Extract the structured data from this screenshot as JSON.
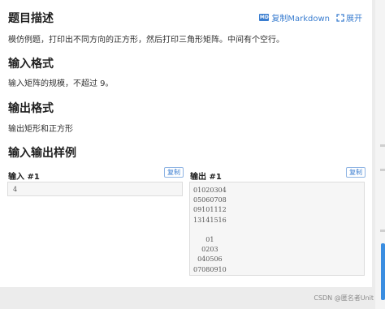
{
  "toolbar": {
    "copy_markdown_label": "复制Markdown",
    "expand_label": "展开",
    "md_badge": "MD",
    "accent": "#3b7ed0"
  },
  "sections": {
    "description": {
      "title": "题目描述",
      "text": "模仿例题，打印出不同方向的正方形，然后打印三角形矩阵。中间有个空行。"
    },
    "input_format": {
      "title": "输入格式",
      "text": "输入矩阵的规模，不超过 9。"
    },
    "output_format": {
      "title": "输出格式",
      "text": "输出矩形和正方形"
    },
    "samples": {
      "title": "输入输出样例",
      "input_label": "输入 #1",
      "output_label": "输出 #1",
      "copy_label": "复制",
      "input_lines": [
        "4"
      ],
      "output_lines": [
        "01020304",
        "05060708",
        "09101112",
        "13141516",
        "",
        "      01",
        "    0203",
        "  040506",
        "07080910"
      ]
    }
  },
  "watermark": "CSDN @匿名者Unit"
}
